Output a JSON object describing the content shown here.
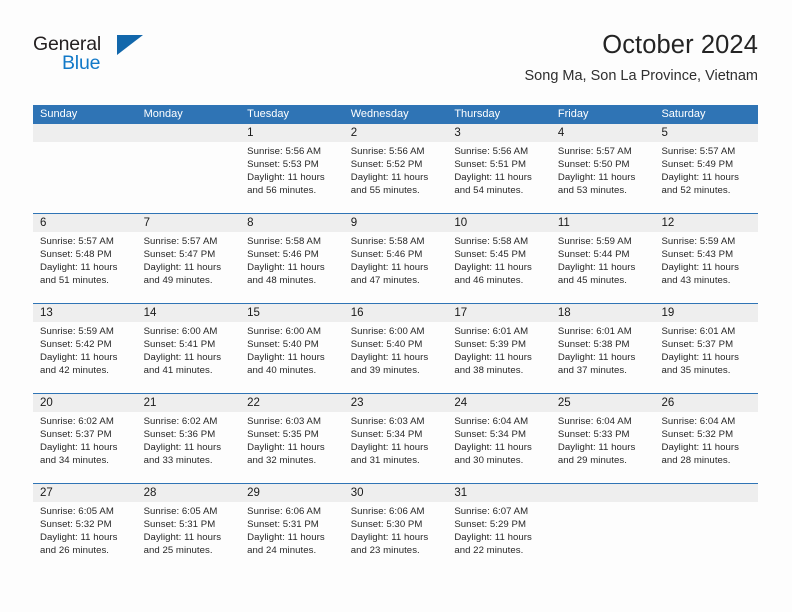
{
  "logo": {
    "word_one": "General",
    "word_two": "Blue",
    "triangle_icon": "blue-triangle-icon"
  },
  "header": {
    "title": "October 2024",
    "subtitle": "Song Ma, Son La Province, Vietnam"
  },
  "colors": {
    "header_blue": "#2f74b5",
    "daynum_band": "#eeeeee",
    "logo_blue": "#1279c8",
    "page_background": "#fdfdfd",
    "text": "#272727"
  },
  "calendar": {
    "weekday_headers": [
      "Sunday",
      "Monday",
      "Tuesday",
      "Wednesday",
      "Thursday",
      "Friday",
      "Saturday"
    ],
    "weeks": [
      [
        {
          "day": "",
          "lines": []
        },
        {
          "day": "",
          "lines": []
        },
        {
          "day": "1",
          "lines": [
            "Sunrise: 5:56 AM",
            "Sunset: 5:53 PM",
            "Daylight: 11 hours",
            "and 56 minutes."
          ]
        },
        {
          "day": "2",
          "lines": [
            "Sunrise: 5:56 AM",
            "Sunset: 5:52 PM",
            "Daylight: 11 hours",
            "and 55 minutes."
          ]
        },
        {
          "day": "3",
          "lines": [
            "Sunrise: 5:56 AM",
            "Sunset: 5:51 PM",
            "Daylight: 11 hours",
            "and 54 minutes."
          ]
        },
        {
          "day": "4",
          "lines": [
            "Sunrise: 5:57 AM",
            "Sunset: 5:50 PM",
            "Daylight: 11 hours",
            "and 53 minutes."
          ]
        },
        {
          "day": "5",
          "lines": [
            "Sunrise: 5:57 AM",
            "Sunset: 5:49 PM",
            "Daylight: 11 hours",
            "and 52 minutes."
          ]
        }
      ],
      [
        {
          "day": "6",
          "lines": [
            "Sunrise: 5:57 AM",
            "Sunset: 5:48 PM",
            "Daylight: 11 hours",
            "and 51 minutes."
          ]
        },
        {
          "day": "7",
          "lines": [
            "Sunrise: 5:57 AM",
            "Sunset: 5:47 PM",
            "Daylight: 11 hours",
            "and 49 minutes."
          ]
        },
        {
          "day": "8",
          "lines": [
            "Sunrise: 5:58 AM",
            "Sunset: 5:46 PM",
            "Daylight: 11 hours",
            "and 48 minutes."
          ]
        },
        {
          "day": "9",
          "lines": [
            "Sunrise: 5:58 AM",
            "Sunset: 5:46 PM",
            "Daylight: 11 hours",
            "and 47 minutes."
          ]
        },
        {
          "day": "10",
          "lines": [
            "Sunrise: 5:58 AM",
            "Sunset: 5:45 PM",
            "Daylight: 11 hours",
            "and 46 minutes."
          ]
        },
        {
          "day": "11",
          "lines": [
            "Sunrise: 5:59 AM",
            "Sunset: 5:44 PM",
            "Daylight: 11 hours",
            "and 45 minutes."
          ]
        },
        {
          "day": "12",
          "lines": [
            "Sunrise: 5:59 AM",
            "Sunset: 5:43 PM",
            "Daylight: 11 hours",
            "and 43 minutes."
          ]
        }
      ],
      [
        {
          "day": "13",
          "lines": [
            "Sunrise: 5:59 AM",
            "Sunset: 5:42 PM",
            "Daylight: 11 hours",
            "and 42 minutes."
          ]
        },
        {
          "day": "14",
          "lines": [
            "Sunrise: 6:00 AM",
            "Sunset: 5:41 PM",
            "Daylight: 11 hours",
            "and 41 minutes."
          ]
        },
        {
          "day": "15",
          "lines": [
            "Sunrise: 6:00 AM",
            "Sunset: 5:40 PM",
            "Daylight: 11 hours",
            "and 40 minutes."
          ]
        },
        {
          "day": "16",
          "lines": [
            "Sunrise: 6:00 AM",
            "Sunset: 5:40 PM",
            "Daylight: 11 hours",
            "and 39 minutes."
          ]
        },
        {
          "day": "17",
          "lines": [
            "Sunrise: 6:01 AM",
            "Sunset: 5:39 PM",
            "Daylight: 11 hours",
            "and 38 minutes."
          ]
        },
        {
          "day": "18",
          "lines": [
            "Sunrise: 6:01 AM",
            "Sunset: 5:38 PM",
            "Daylight: 11 hours",
            "and 37 minutes."
          ]
        },
        {
          "day": "19",
          "lines": [
            "Sunrise: 6:01 AM",
            "Sunset: 5:37 PM",
            "Daylight: 11 hours",
            "and 35 minutes."
          ]
        }
      ],
      [
        {
          "day": "20",
          "lines": [
            "Sunrise: 6:02 AM",
            "Sunset: 5:37 PM",
            "Daylight: 11 hours",
            "and 34 minutes."
          ]
        },
        {
          "day": "21",
          "lines": [
            "Sunrise: 6:02 AM",
            "Sunset: 5:36 PM",
            "Daylight: 11 hours",
            "and 33 minutes."
          ]
        },
        {
          "day": "22",
          "lines": [
            "Sunrise: 6:03 AM",
            "Sunset: 5:35 PM",
            "Daylight: 11 hours",
            "and 32 minutes."
          ]
        },
        {
          "day": "23",
          "lines": [
            "Sunrise: 6:03 AM",
            "Sunset: 5:34 PM",
            "Daylight: 11 hours",
            "and 31 minutes."
          ]
        },
        {
          "day": "24",
          "lines": [
            "Sunrise: 6:04 AM",
            "Sunset: 5:34 PM",
            "Daylight: 11 hours",
            "and 30 minutes."
          ]
        },
        {
          "day": "25",
          "lines": [
            "Sunrise: 6:04 AM",
            "Sunset: 5:33 PM",
            "Daylight: 11 hours",
            "and 29 minutes."
          ]
        },
        {
          "day": "26",
          "lines": [
            "Sunrise: 6:04 AM",
            "Sunset: 5:32 PM",
            "Daylight: 11 hours",
            "and 28 minutes."
          ]
        }
      ],
      [
        {
          "day": "27",
          "lines": [
            "Sunrise: 6:05 AM",
            "Sunset: 5:32 PM",
            "Daylight: 11 hours",
            "and 26 minutes."
          ]
        },
        {
          "day": "28",
          "lines": [
            "Sunrise: 6:05 AM",
            "Sunset: 5:31 PM",
            "Daylight: 11 hours",
            "and 25 minutes."
          ]
        },
        {
          "day": "29",
          "lines": [
            "Sunrise: 6:06 AM",
            "Sunset: 5:31 PM",
            "Daylight: 11 hours",
            "and 24 minutes."
          ]
        },
        {
          "day": "30",
          "lines": [
            "Sunrise: 6:06 AM",
            "Sunset: 5:30 PM",
            "Daylight: 11 hours",
            "and 23 minutes."
          ]
        },
        {
          "day": "31",
          "lines": [
            "Sunrise: 6:07 AM",
            "Sunset: 5:29 PM",
            "Daylight: 11 hours",
            "and 22 minutes."
          ]
        },
        {
          "day": "",
          "lines": []
        },
        {
          "day": "",
          "lines": []
        }
      ]
    ]
  }
}
